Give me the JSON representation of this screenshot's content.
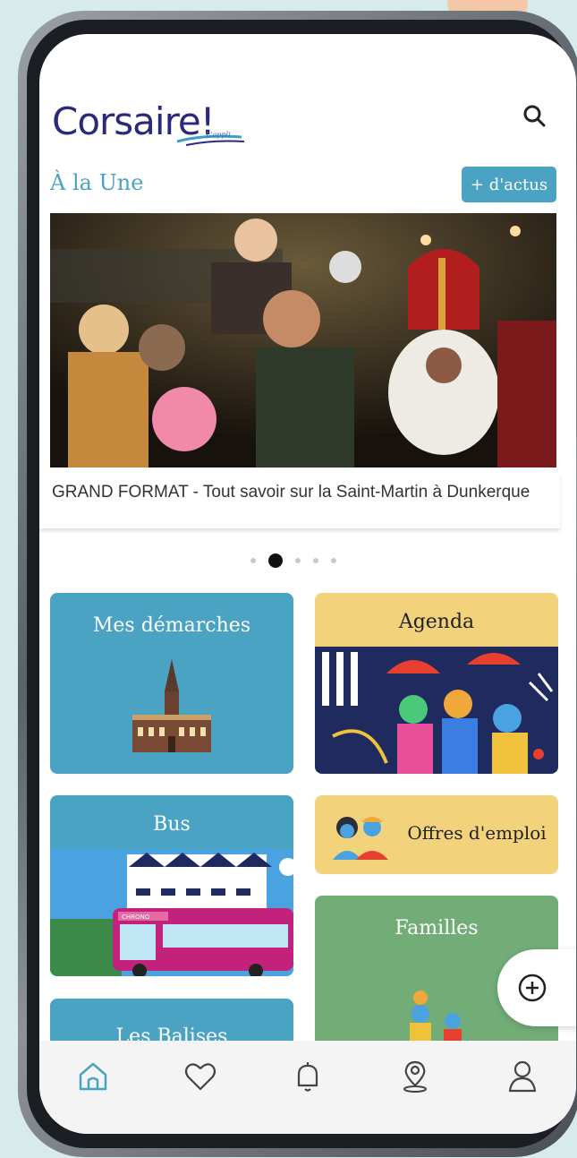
{
  "header": {
    "logo_text": "Corsaire!",
    "logo_tagline": "L'appli"
  },
  "featured": {
    "title": "À la Une",
    "more_label": "+ d'actus",
    "caption": "GRAND FORMAT - Tout savoir sur la Saint-Martin à Dunkerque",
    "carousel": {
      "count": 5,
      "active_index": 1
    }
  },
  "tiles": [
    {
      "label": "Mes démarches",
      "color": "#4aa3c2"
    },
    {
      "label": "Agenda",
      "color": "#f2d27a"
    },
    {
      "label": "Bus",
      "color": "#4aa3c2"
    },
    {
      "label": "Offres d'emploi",
      "color": "#f2d27a"
    },
    {
      "label": "Familles",
      "color": "#72ad78"
    },
    {
      "label": "Les Balises",
      "color": "#4aa3c2"
    }
  ],
  "bus_badge": "CHRONO",
  "fab_icon": "plus-circle-icon",
  "bottom_nav": [
    {
      "icon": "home-icon",
      "active": true
    },
    {
      "icon": "heart-icon",
      "active": false
    },
    {
      "icon": "bell-icon",
      "active": false
    },
    {
      "icon": "map-pin-icon",
      "active": false
    },
    {
      "icon": "user-icon",
      "active": false
    }
  ],
  "colors": {
    "accent": "#4aa3c2",
    "logo": "#2b2a7a",
    "yellow": "#f2d27a",
    "green": "#72ad78"
  }
}
